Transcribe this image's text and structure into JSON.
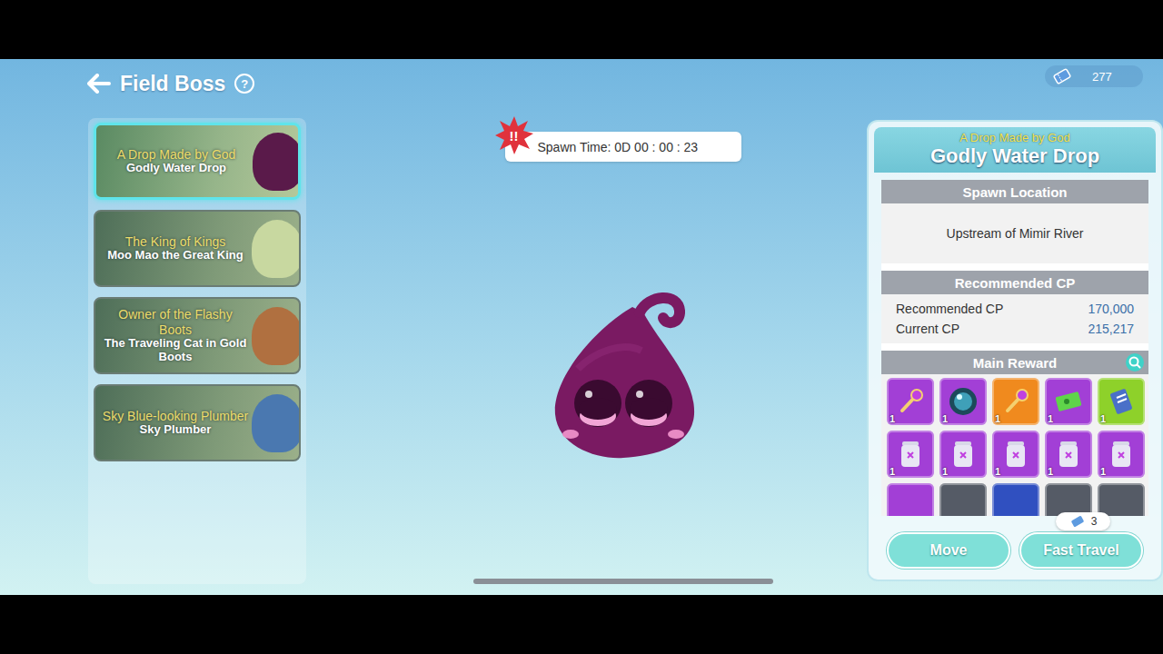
{
  "header": {
    "title": "Field Boss",
    "help": "?"
  },
  "currency": {
    "amount": "277"
  },
  "bosses": [
    {
      "subtitle": "A Drop Made by God",
      "name": "Godly Water Drop",
      "selected": true,
      "color": "#5a1a4a"
    },
    {
      "subtitle": "The King of Kings",
      "name": "Moo Mao the Great King",
      "selected": false,
      "color": "#c8d8a0"
    },
    {
      "subtitle": "Owner of the Flashy Boots",
      "name": "The Traveling Cat in Gold Boots",
      "selected": false,
      "color": "#b07040"
    },
    {
      "subtitle": "Sky Blue-looking Plumber",
      "name": "Sky Plumber",
      "selected": false,
      "color": "#4a78b0"
    }
  ],
  "spawn": {
    "alert": "!!",
    "label": "Spawn Time: 0D 00 : 00 : 23"
  },
  "detail": {
    "subtitle": "A Drop Made by God",
    "name": "Godly Water Drop",
    "location": {
      "title": "Spawn Location",
      "value": "Upstream of Mimir River"
    },
    "cp": {
      "title": "Recommended CP",
      "rows": [
        {
          "label": "Recommended CP",
          "value": "170,000"
        },
        {
          "label": "Current CP",
          "value": "215,217"
        }
      ]
    },
    "rewards": {
      "title": "Main Reward",
      "items": [
        {
          "kind": "key",
          "color": "#a23fd6",
          "count": "1"
        },
        {
          "kind": "orb",
          "color": "#a23fd6",
          "count": "1"
        },
        {
          "kind": "key",
          "color": "#f08a1e",
          "count": "1"
        },
        {
          "kind": "ticket",
          "color": "#a23fd6",
          "count": "1"
        },
        {
          "kind": "scroll",
          "color": "#8ed12a",
          "count": "1"
        },
        {
          "kind": "jar",
          "color": "#a23fd6",
          "count": "1"
        },
        {
          "kind": "jar",
          "color": "#a23fd6",
          "count": "1"
        },
        {
          "kind": "jar",
          "color": "#a23fd6",
          "count": "1"
        },
        {
          "kind": "jar",
          "color": "#a23fd6",
          "count": "1"
        },
        {
          "kind": "jar",
          "color": "#a23fd6",
          "count": "1"
        },
        {
          "kind": "unknown",
          "color": "#a23fd6"
        },
        {
          "kind": "unknown",
          "color": "#555b66"
        },
        {
          "kind": "unknown",
          "color": "#3050c0"
        },
        {
          "kind": "unknown",
          "color": "#555b66"
        },
        {
          "kind": "unknown",
          "color": "#555b66"
        }
      ]
    },
    "travel_cost": "3",
    "buttons": [
      "Move",
      "Fast Travel"
    ]
  }
}
